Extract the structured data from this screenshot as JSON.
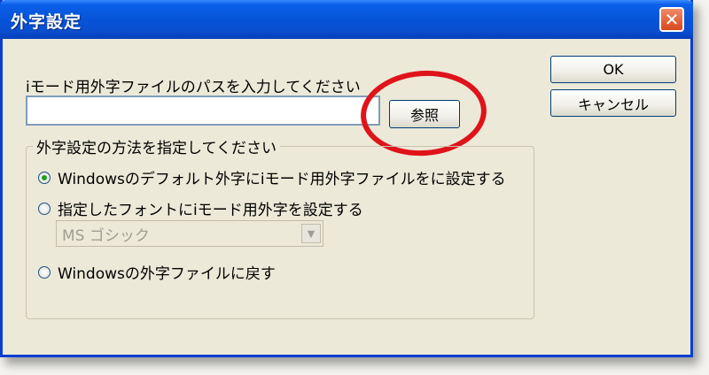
{
  "window": {
    "title": "外字設定"
  },
  "path": {
    "label": "iモード用外字ファイルのパスを入力してください",
    "value": "",
    "browse_label": "参照"
  },
  "buttons": {
    "ok_label": "OK",
    "cancel_label": "キャンセル"
  },
  "method_group": {
    "legend": "外字設定の方法を指定してください",
    "options": [
      {
        "label": "Windowsのデフォルト外字にiモード用外字ファイルをに設定する",
        "checked": true
      },
      {
        "label": "指定したフォントにiモード用外字を設定する",
        "checked": false
      },
      {
        "label": "Windowsの外字ファイルに戻す",
        "checked": false
      }
    ],
    "font_select": {
      "value": "MS ゴシック",
      "disabled": true
    }
  },
  "colors": {
    "titlebar": "#0654d8",
    "window_bg": "#ece9d8",
    "highlight_ring": "#e0131a",
    "radio_checked": "#21a121"
  }
}
